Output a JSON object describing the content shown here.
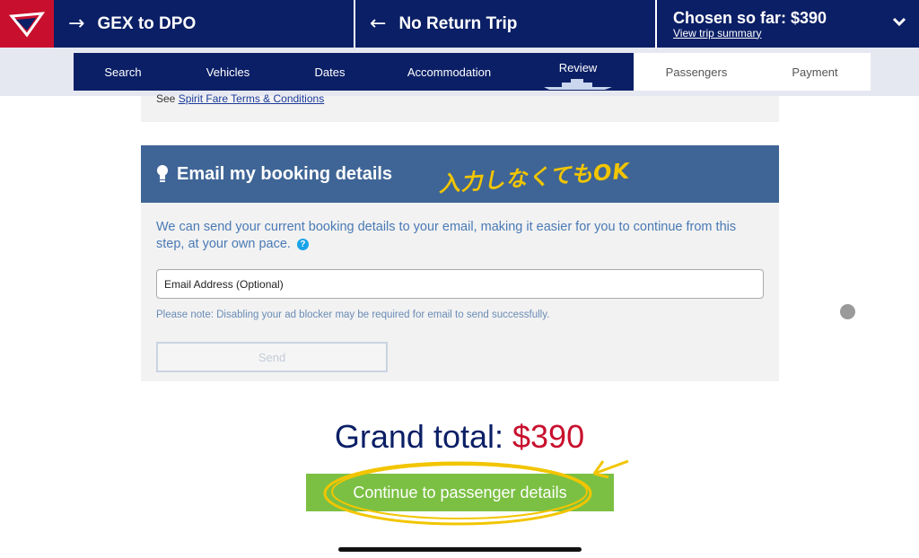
{
  "header": {
    "outbound": {
      "arrow": "→",
      "label": "GEX to DPO"
    },
    "return": {
      "arrow": "←",
      "label": "No Return Trip"
    },
    "summary": {
      "chosen": "Chosen so far: $390",
      "view_link": "View trip summary",
      "chevron": "⌄"
    }
  },
  "steps": [
    {
      "label": "Search",
      "state": "done"
    },
    {
      "label": "Vehicles",
      "state": "done"
    },
    {
      "label": "Dates",
      "state": "done"
    },
    {
      "label": "Accommodation",
      "state": "done"
    },
    {
      "label": "Review",
      "state": "active"
    },
    {
      "label": "Passengers",
      "state": "todo"
    },
    {
      "label": "Payment",
      "state": "todo"
    }
  ],
  "terms": {
    "prefix": "See ",
    "link": "Spirit Fare Terms & Conditions"
  },
  "email": {
    "icon": "lightbulb-icon",
    "title": "Email my booking details",
    "handwritten_note": "入力しなくてもOK",
    "description": "We can send your current booking details to your email, making it easier for you to continue from this step, at your own pace.",
    "help": "?",
    "input_placeholder": "Email Address (Optional)",
    "input_value": "",
    "note": "Please note: Disabling your ad blocker may be required for email to send successfully.",
    "send_label": "Send"
  },
  "total": {
    "label": "Grand total: ",
    "amount": "$390"
  },
  "continue_label": "Continue to passenger details",
  "colors": {
    "navy": "#0b1f66",
    "red": "#c8102e",
    "panel_blue": "#3f6596",
    "green": "#7bc043",
    "annotation_yellow": "#f2c500"
  }
}
